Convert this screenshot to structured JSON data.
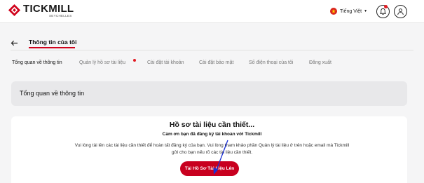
{
  "header": {
    "brand": "TICKMILL",
    "brand_sub": "SEYCHELLES",
    "language": "Tiếng Việt",
    "icons": {
      "notifications": "bell-icon",
      "profile": "user-icon",
      "language_flag": "vietnam-flag-icon"
    }
  },
  "page": {
    "title": "Thông tin của tôi"
  },
  "tabs": [
    {
      "label": "Tổng quan về thông tin",
      "active": true
    },
    {
      "label": "Quản lý hồ sơ tài liệu",
      "active": false,
      "has_badge": true
    },
    {
      "label": "Cài đặt tài khoản",
      "active": false
    },
    {
      "label": "Cài đặt bảo mật",
      "active": false
    },
    {
      "label": "Số điện thoại của tôi",
      "active": false
    },
    {
      "label": "Đăng xuất",
      "active": false
    }
  ],
  "overview": {
    "section_title": "Tổng quan về thông tin"
  },
  "documents": {
    "title": "Hồ sơ tài liệu cần thiết...",
    "subtitle": "Cảm ơn bạn đã đăng ký tài khoản với Tickmill",
    "body": "Vui lòng tải lên các tài liệu cần thiết để hoàn tất đăng ký của bạn. Vui lòng tham khảo phần Quản lý tài liệu ở trên hoặc email mà Tickmill gửi cho bạn nếu rõ các tài liệu cần thiết.",
    "upload_button": "Tải Hồ Sơ Tài Liệu Lên"
  },
  "colors": {
    "accent": "#c8001f",
    "badge": "#e31b23",
    "annotation_arrow": "#1a2fd6",
    "page_bg": "#f5f5f6",
    "card_bg": "#e8e8ea"
  }
}
